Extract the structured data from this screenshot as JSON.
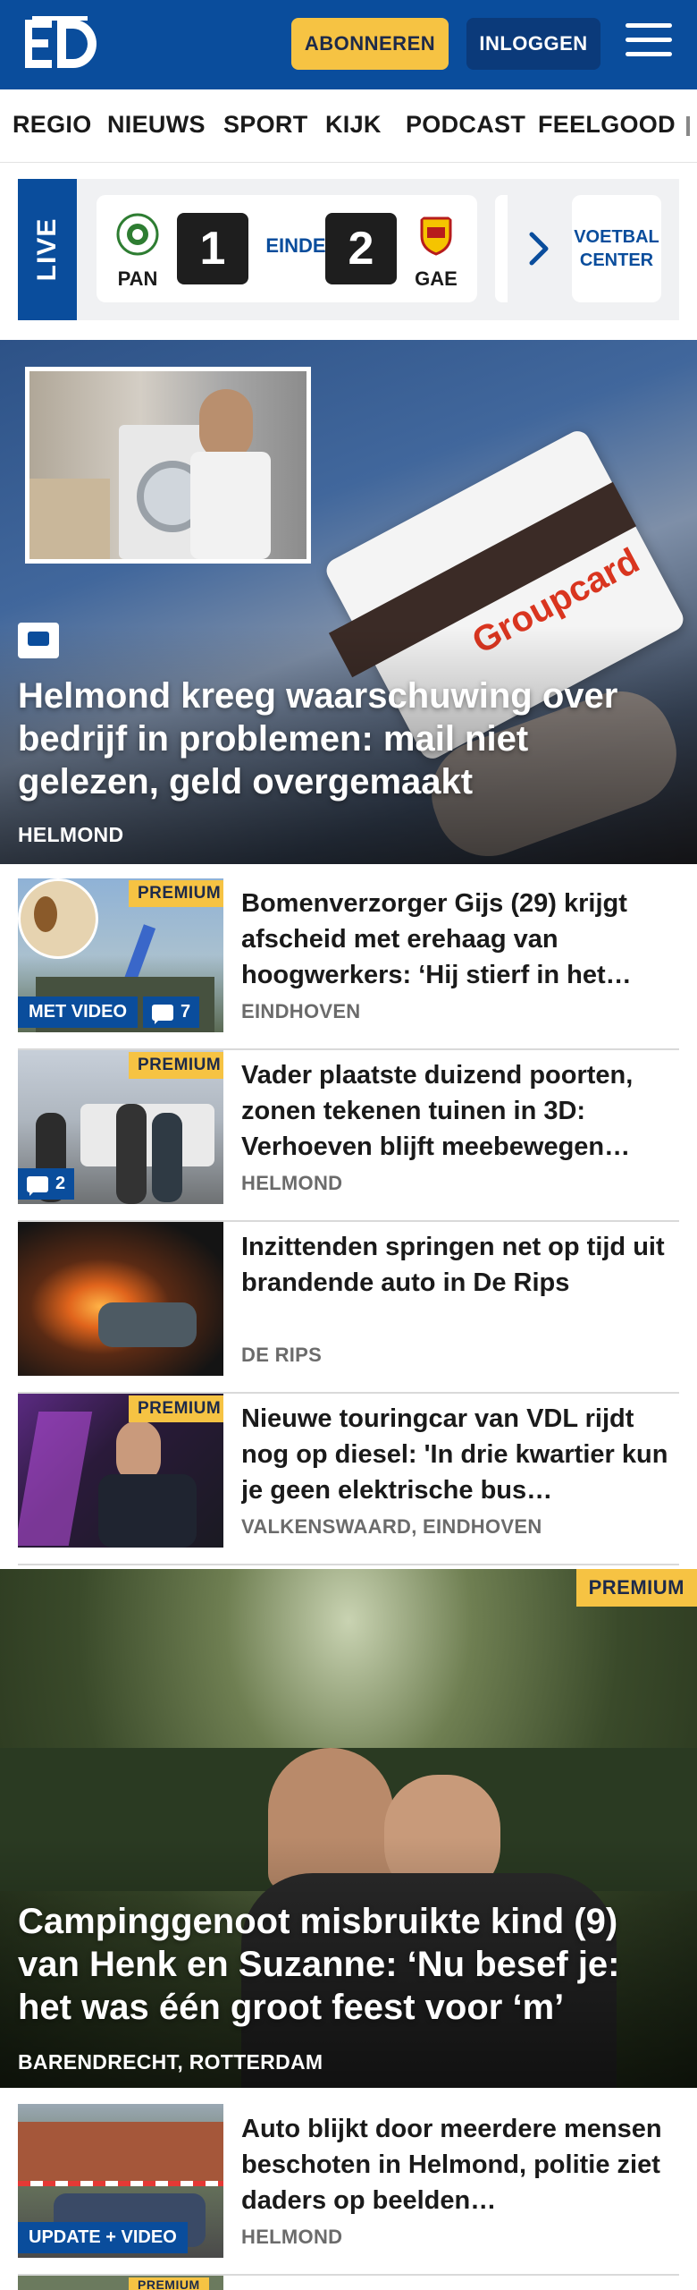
{
  "header": {
    "logo_text": "ED",
    "subscribe_label": "ABONNEREN",
    "login_label": "INLOGGEN",
    "colors": {
      "brand_blue": "#0a4d9c",
      "accent_yellow": "#f6c343"
    }
  },
  "nav": {
    "items": [
      "REGIO",
      "NIEUWS",
      "SPORT",
      "KIJK",
      "PODCAST",
      "FEELGOOD"
    ]
  },
  "live": {
    "tag": "LIVE",
    "match": {
      "home_abbr": "PAN",
      "home_score": "1",
      "status": "EINDE",
      "away_score": "2",
      "away_abbr": "GAE"
    },
    "football_center_label": "VOETBAL CENTER"
  },
  "hero1": {
    "title": "Helmond kreeg waarschuwing over bedrijf in problemen: mail niet gelezen, geld overgemaakt",
    "region": "HELMOND",
    "image_text": "Groupcard"
  },
  "articles": [
    {
      "title": "Bomenverzorger Gijs (29) krijgt afscheid met erehaag van hoogwerkers: ‘Hij stierf in het…",
      "region": "EINDHOVEN",
      "premium": "PREMIUM",
      "video": "MET VIDEO",
      "comments": "7"
    },
    {
      "title": "Vader plaatste duizend poorten, zonen tekenen tuinen in 3D: Verhoeven blijft meebewegen…",
      "region": "HELMOND",
      "premium": "PREMIUM",
      "comments": "2"
    },
    {
      "title": "Inzittenden springen net op tijd uit brandende auto in De Rips",
      "region": "DE RIPS"
    },
    {
      "title": "Nieuwe touringcar van VDL rijdt nog op diesel: 'In drie kwartier kun je geen elektrische bus…",
      "region": "VALKENSWAARD, EINDHOVEN",
      "premium": "PREMIUM"
    }
  ],
  "hero2": {
    "title": "Campinggenoot misbruikte kind (9) van Henk en Suzanne: ‘Nu besef je: het was één groot feest voor ‘m’",
    "region": "BARENDRECHT, ROTTERDAM",
    "premium": "PREMIUM"
  },
  "articles2": [
    {
      "title": "Auto blijkt door meerdere mensen beschoten in Helmond, politie ziet daders op beelden…",
      "region": "HELMOND",
      "video": "UPDATE + VIDEO"
    }
  ],
  "partial_item": {
    "premium": "PREMIUM"
  }
}
